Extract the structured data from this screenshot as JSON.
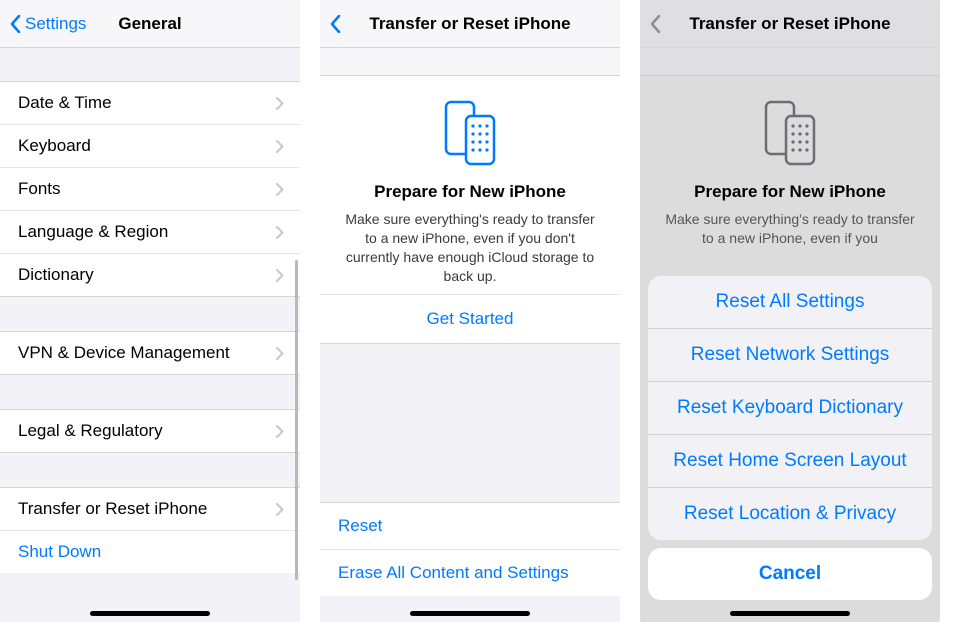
{
  "screen1": {
    "back_label": "Settings",
    "title": "General",
    "groups": {
      "g1": [
        "Date & Time",
        "Keyboard",
        "Fonts",
        "Language & Region",
        "Dictionary"
      ],
      "g2": [
        "VPN & Device Management"
      ],
      "g3": [
        "Legal & Regulatory"
      ],
      "g4": [
        "Transfer or Reset iPhone"
      ],
      "shutdown": "Shut Down"
    }
  },
  "screen2": {
    "title": "Transfer or Reset iPhone",
    "prepare_title": "Prepare for New iPhone",
    "prepare_desc": "Make sure everything's ready to transfer to a new iPhone, even if you don't currently have enough iCloud storage to back up.",
    "get_started": "Get Started",
    "bottom": {
      "reset": "Reset",
      "erase": "Erase All Content and Settings"
    }
  },
  "screen3": {
    "title": "Transfer or Reset iPhone",
    "prepare_title": "Prepare for New iPhone",
    "prepare_desc": "Make sure everything's ready to transfer to a new iPhone, even if you",
    "action_sheet": {
      "o1": "Reset All Settings",
      "o2": "Reset Network Settings",
      "o3": "Reset Keyboard Dictionary",
      "o4": "Reset Home Screen Layout",
      "o5": "Reset Location & Privacy",
      "cancel": "Cancel"
    }
  },
  "colors": {
    "ios_blue": "#007aff",
    "dim_gray": "#8e8e93"
  }
}
